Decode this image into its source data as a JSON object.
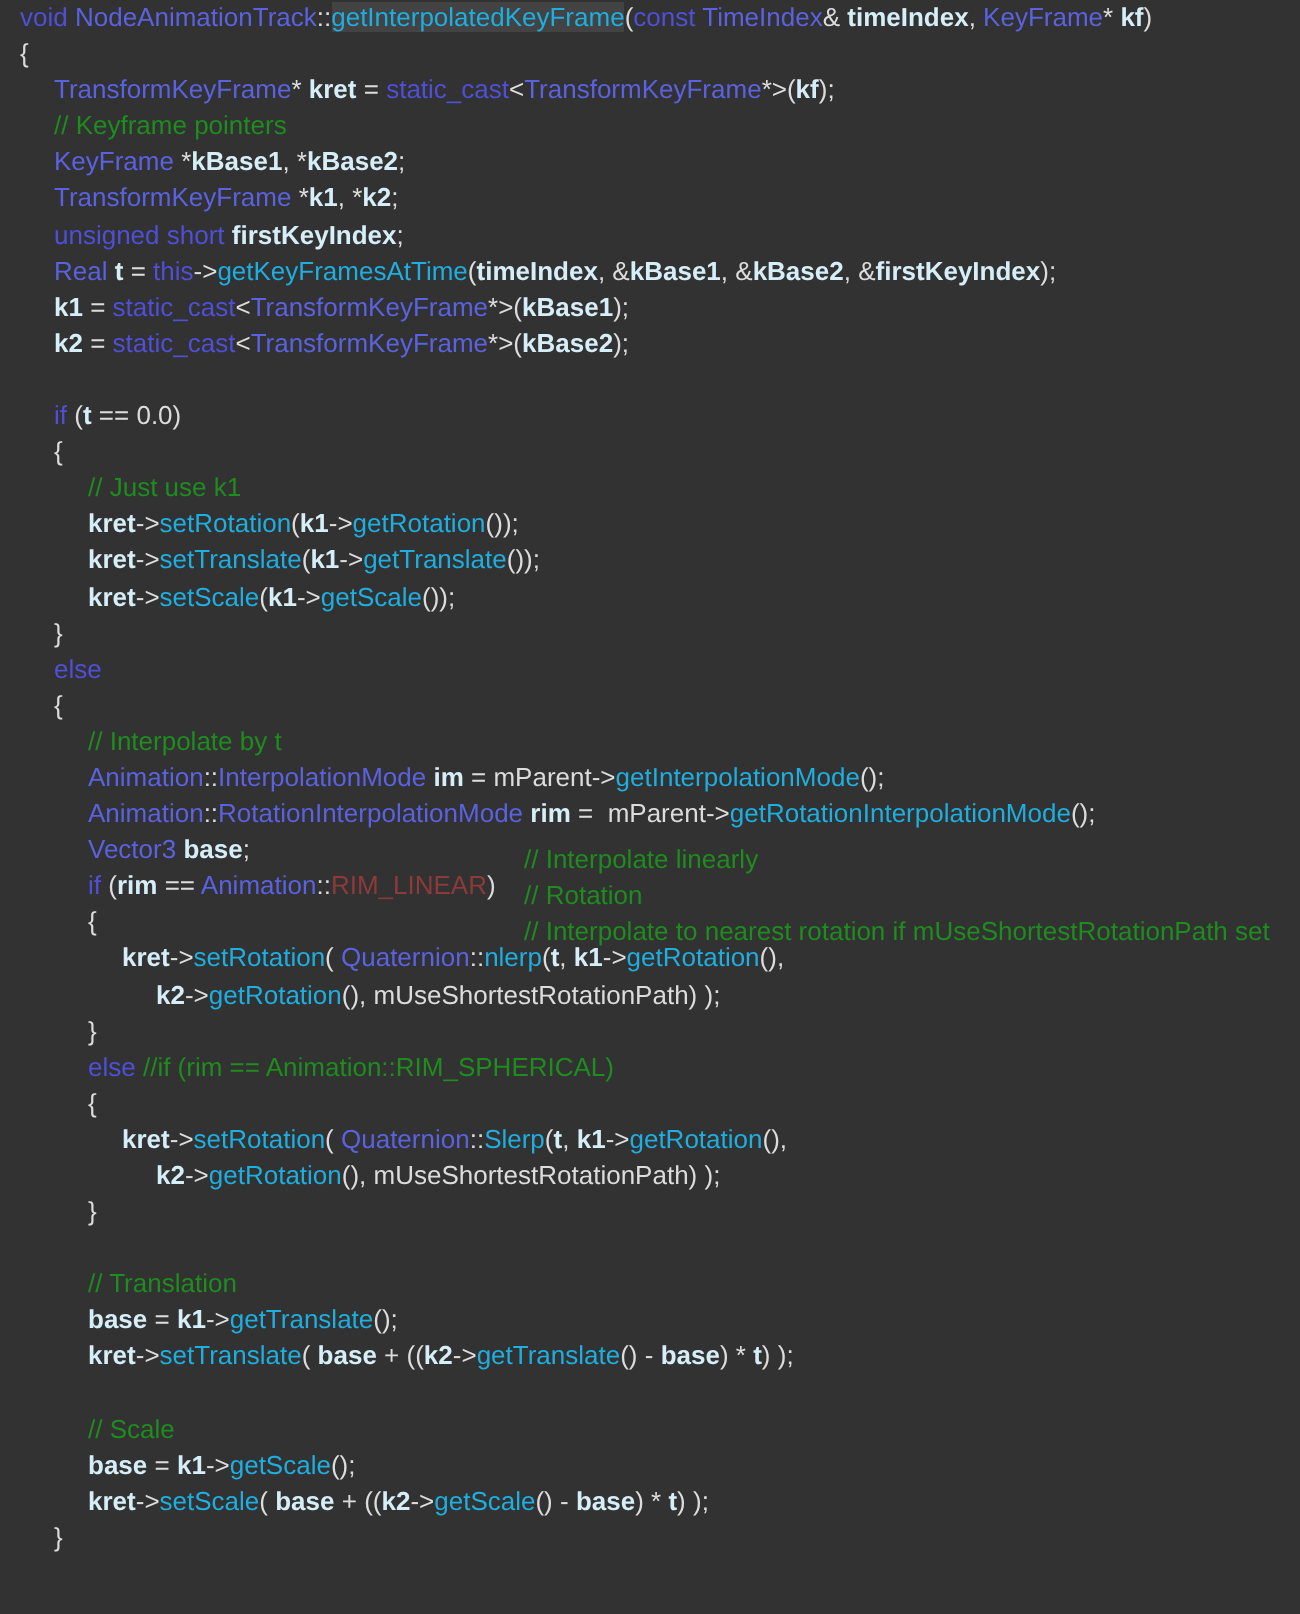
{
  "editor": {
    "lines": [
      {
        "kind": "code",
        "tokens": [
          {
            "kind": "kw",
            "text": "void "
          },
          {
            "kind": "type",
            "text": "NodeAnimationTrack"
          },
          {
            "kind": "op",
            "text": "::"
          },
          {
            "kind": "fnh",
            "text": "getInterpolatedKeyFrame"
          },
          {
            "kind": "op",
            "text": "("
          },
          {
            "kind": "kw",
            "text": "const "
          },
          {
            "kind": "type",
            "text": "TimeIndex"
          },
          {
            "kind": "op",
            "text": "& "
          },
          {
            "kind": "var",
            "text": "timeIndex"
          },
          {
            "kind": "op",
            "text": ", "
          },
          {
            "kind": "type",
            "text": "KeyFrame"
          },
          {
            "kind": "op",
            "text": "* "
          },
          {
            "kind": "var",
            "text": "kf"
          },
          {
            "kind": "op",
            "text": ")"
          }
        ]
      },
      {
        "kind": "code",
        "tokens": [
          {
            "kind": "op",
            "text": "{"
          }
        ]
      },
      {
        "kind": "code",
        "tokens": [
          {
            "kind": "type",
            "text": "\tTransformKeyFrame"
          },
          {
            "kind": "op",
            "text": "* "
          },
          {
            "kind": "var",
            "text": "kret"
          },
          {
            "kind": "op",
            "text": " = "
          },
          {
            "kind": "kw",
            "text": "static_cast"
          },
          {
            "kind": "op",
            "text": "<"
          },
          {
            "kind": "type",
            "text": "TransformKeyFrame"
          },
          {
            "kind": "op",
            "text": "*>("
          },
          {
            "kind": "var",
            "text": "kf"
          },
          {
            "kind": "op",
            "text": ");"
          }
        ]
      },
      {
        "kind": "code",
        "tokens": [
          {
            "kind": "comment",
            "text": "\t// Keyframe pointers"
          }
        ]
      },
      {
        "kind": "code",
        "tokens": [
          {
            "kind": "type",
            "text": "\tKeyFrame "
          },
          {
            "kind": "op",
            "text": "*"
          },
          {
            "kind": "var",
            "text": "kBase1"
          },
          {
            "kind": "op",
            "text": ", *"
          },
          {
            "kind": "var",
            "text": "kBase2"
          },
          {
            "kind": "op",
            "text": ";"
          }
        ]
      },
      {
        "kind": "code",
        "tokens": [
          {
            "kind": "type",
            "text": "\tTransformKeyFrame "
          },
          {
            "kind": "op",
            "text": "*"
          },
          {
            "kind": "var",
            "text": "k1"
          },
          {
            "kind": "op",
            "text": ", *"
          },
          {
            "kind": "var",
            "text": "k2"
          },
          {
            "kind": "op",
            "text": ";"
          }
        ]
      },
      {
        "kind": "code",
        "tokens": [
          {
            "kind": "kw",
            "text": "\tunsigned short "
          },
          {
            "kind": "var",
            "text": "firstKeyIndex"
          },
          {
            "kind": "op",
            "text": ";"
          }
        ]
      },
      {
        "kind": "code",
        "tokens": [
          {
            "kind": "type",
            "text": "\tReal "
          },
          {
            "kind": "var",
            "text": "t"
          },
          {
            "kind": "op",
            "text": " = "
          },
          {
            "kind": "kw",
            "text": "this"
          },
          {
            "kind": "op",
            "text": "->"
          },
          {
            "kind": "fn",
            "text": "getKeyFramesAtTime"
          },
          {
            "kind": "op",
            "text": "("
          },
          {
            "kind": "var",
            "text": "timeIndex"
          },
          {
            "kind": "op",
            "text": ", &"
          },
          {
            "kind": "var",
            "text": "kBase1"
          },
          {
            "kind": "op",
            "text": ", &"
          },
          {
            "kind": "var",
            "text": "kBase2"
          },
          {
            "kind": "op",
            "text": ", &"
          },
          {
            "kind": "var",
            "text": "firstKeyIndex"
          },
          {
            "kind": "op",
            "text": ");"
          }
        ]
      },
      {
        "kind": "code",
        "tokens": [
          {
            "kind": "var",
            "text": "\tk1"
          },
          {
            "kind": "op",
            "text": " = "
          },
          {
            "kind": "kw",
            "text": "static_cast"
          },
          {
            "kind": "op",
            "text": "<"
          },
          {
            "kind": "type",
            "text": "TransformKeyFrame"
          },
          {
            "kind": "op",
            "text": "*>("
          },
          {
            "kind": "var",
            "text": "kBase1"
          },
          {
            "kind": "op",
            "text": ");"
          }
        ]
      },
      {
        "kind": "code",
        "tokens": [
          {
            "kind": "var",
            "text": "\tk2"
          },
          {
            "kind": "op",
            "text": " = "
          },
          {
            "kind": "kw",
            "text": "static_cast"
          },
          {
            "kind": "op",
            "text": "<"
          },
          {
            "kind": "type",
            "text": "TransformKeyFrame"
          },
          {
            "kind": "op",
            "text": "*>("
          },
          {
            "kind": "var",
            "text": "kBase2"
          },
          {
            "kind": "op",
            "text": ");"
          }
        ]
      },
      {
        "kind": "blank"
      },
      {
        "kind": "code",
        "tokens": [
          {
            "kind": "kw",
            "text": "\tif "
          },
          {
            "kind": "op",
            "text": "("
          },
          {
            "kind": "var",
            "text": "t"
          },
          {
            "kind": "op",
            "text": " == 0.0)"
          }
        ]
      },
      {
        "kind": "code",
        "tokens": [
          {
            "kind": "op",
            "text": "\t{"
          }
        ]
      },
      {
        "kind": "code",
        "tokens": [
          {
            "kind": "comment",
            "text": "\t\t// Just use k1"
          }
        ]
      },
      {
        "kind": "code",
        "tokens": [
          {
            "kind": "var",
            "text": "\t\tkret"
          },
          {
            "kind": "op",
            "text": "->"
          },
          {
            "kind": "fn",
            "text": "setRotation"
          },
          {
            "kind": "op",
            "text": "("
          },
          {
            "kind": "var",
            "text": "k1"
          },
          {
            "kind": "op",
            "text": "->"
          },
          {
            "kind": "fn",
            "text": "getRotation"
          },
          {
            "kind": "op",
            "text": "());"
          }
        ]
      },
      {
        "kind": "code",
        "tokens": [
          {
            "kind": "var",
            "text": "\t\tkret"
          },
          {
            "kind": "op",
            "text": "->"
          },
          {
            "kind": "fn",
            "text": "setTranslate"
          },
          {
            "kind": "op",
            "text": "("
          },
          {
            "kind": "var",
            "text": "k1"
          },
          {
            "kind": "op",
            "text": "->"
          },
          {
            "kind": "fn",
            "text": "getTranslate"
          },
          {
            "kind": "op",
            "text": "());"
          }
        ]
      },
      {
        "kind": "code",
        "tokens": [
          {
            "kind": "var",
            "text": "\t\tkret"
          },
          {
            "kind": "op",
            "text": "->"
          },
          {
            "kind": "fn",
            "text": "setScale"
          },
          {
            "kind": "op",
            "text": "("
          },
          {
            "kind": "var",
            "text": "k1"
          },
          {
            "kind": "op",
            "text": "->"
          },
          {
            "kind": "fn",
            "text": "getScale"
          },
          {
            "kind": "op",
            "text": "());"
          }
        ]
      },
      {
        "kind": "code",
        "tokens": [
          {
            "kind": "op",
            "text": "\t}"
          }
        ]
      },
      {
        "kind": "code",
        "tokens": [
          {
            "kind": "kw",
            "text": "\telse"
          }
        ]
      },
      {
        "kind": "code",
        "tokens": [
          {
            "kind": "op",
            "text": "\t{"
          }
        ]
      },
      {
        "kind": "code",
        "tokens": [
          {
            "kind": "comment",
            "text": "\t\t// Interpolate by t"
          }
        ]
      },
      {
        "kind": "code",
        "tokens": [
          {
            "kind": "type",
            "text": "\t\tAnimation"
          },
          {
            "kind": "op",
            "text": "::"
          },
          {
            "kind": "type",
            "text": "InterpolationMode "
          },
          {
            "kind": "var",
            "text": "im"
          },
          {
            "kind": "op",
            "text": " = mParent->"
          },
          {
            "kind": "fn",
            "text": "getInterpolationMode"
          },
          {
            "kind": "op",
            "text": "();"
          }
        ]
      },
      {
        "kind": "code",
        "tokens": [
          {
            "kind": "type",
            "text": "\t\tAnimation"
          },
          {
            "kind": "op",
            "text": "::"
          },
          {
            "kind": "type",
            "text": "RotationInterpolationMode "
          },
          {
            "kind": "var",
            "text": "rim"
          },
          {
            "kind": "op",
            "text": " =  mParent->"
          },
          {
            "kind": "fn",
            "text": "getRotationInterpolationMode"
          },
          {
            "kind": "op",
            "text": "();"
          }
        ]
      },
      {
        "kind": "code",
        "tokens": [
          {
            "kind": "type",
            "text": "\t\tVector3 "
          },
          {
            "kind": "var",
            "text": "base"
          },
          {
            "kind": "op",
            "text": ";"
          }
        ],
        "side_comment": "// Interpolate linearly"
      },
      {
        "kind": "code",
        "tokens": [
          {
            "kind": "kw",
            "text": "\t\tif "
          },
          {
            "kind": "op",
            "text": "("
          },
          {
            "kind": "var",
            "text": "rim"
          },
          {
            "kind": "op",
            "text": " == "
          },
          {
            "kind": "type",
            "text": "Animation"
          },
          {
            "kind": "op",
            "text": "::"
          },
          {
            "kind": "enum",
            "text": "RIM_LINEAR"
          },
          {
            "kind": "op",
            "text": ")"
          }
        ],
        "side_comment": "// Rotation"
      },
      {
        "kind": "code",
        "tokens": [
          {
            "kind": "op",
            "text": "\t\t{"
          }
        ],
        "side_comment": "// Interpolate to nearest rotation if mUseShortestRotationPath set"
      },
      {
        "kind": "code",
        "tokens": [
          {
            "kind": "var",
            "text": "\t\t\tkret"
          },
          {
            "kind": "op",
            "text": "->"
          },
          {
            "kind": "fn",
            "text": "setRotation"
          },
          {
            "kind": "op",
            "text": "( "
          },
          {
            "kind": "type",
            "text": "Quaternion"
          },
          {
            "kind": "op",
            "text": "::"
          },
          {
            "kind": "fn",
            "text": "nlerp"
          },
          {
            "kind": "op",
            "text": "("
          },
          {
            "kind": "var",
            "text": "t"
          },
          {
            "kind": "op",
            "text": ", "
          },
          {
            "kind": "var",
            "text": "k1"
          },
          {
            "kind": "op",
            "text": "->"
          },
          {
            "kind": "fn",
            "text": "getRotation"
          },
          {
            "kind": "op",
            "text": "(),"
          }
        ]
      },
      {
        "kind": "code",
        "tokens": [
          {
            "kind": "var",
            "text": "\t\t\t\tk2"
          },
          {
            "kind": "op",
            "text": "->"
          },
          {
            "kind": "fn",
            "text": "getRotation"
          },
          {
            "kind": "op",
            "text": "(), mUseShortestRotationPath) );"
          }
        ]
      },
      {
        "kind": "code",
        "tokens": [
          {
            "kind": "op",
            "text": "\t\t}"
          }
        ]
      },
      {
        "kind": "code",
        "tokens": [
          {
            "kind": "kw",
            "text": "\t\telse "
          },
          {
            "kind": "comment",
            "text": "//if (rim == Animation::RIM_SPHERICAL)"
          }
        ]
      },
      {
        "kind": "code",
        "tokens": [
          {
            "kind": "op",
            "text": "\t\t{"
          }
        ]
      },
      {
        "kind": "code",
        "tokens": [
          {
            "kind": "var",
            "text": "\t\t\tkret"
          },
          {
            "kind": "op",
            "text": "->"
          },
          {
            "kind": "fn",
            "text": "setRotation"
          },
          {
            "kind": "op",
            "text": "( "
          },
          {
            "kind": "type",
            "text": "Quaternion"
          },
          {
            "kind": "op",
            "text": "::"
          },
          {
            "kind": "fn",
            "text": "Slerp"
          },
          {
            "kind": "op",
            "text": "("
          },
          {
            "kind": "var",
            "text": "t"
          },
          {
            "kind": "op",
            "text": ", "
          },
          {
            "kind": "var",
            "text": "k1"
          },
          {
            "kind": "op",
            "text": "->"
          },
          {
            "kind": "fn",
            "text": "getRotation"
          },
          {
            "kind": "op",
            "text": "(),"
          }
        ]
      },
      {
        "kind": "code",
        "tokens": [
          {
            "kind": "var",
            "text": "\t\t\t\tk2"
          },
          {
            "kind": "op",
            "text": "->"
          },
          {
            "kind": "fn",
            "text": "getRotation"
          },
          {
            "kind": "op",
            "text": "(), mUseShortestRotationPath) );"
          }
        ]
      },
      {
        "kind": "code",
        "tokens": [
          {
            "kind": "op",
            "text": "\t\t}"
          }
        ]
      },
      {
        "kind": "blank"
      },
      {
        "kind": "code",
        "tokens": [
          {
            "kind": "comment",
            "text": "\t\t// Translation"
          }
        ]
      },
      {
        "kind": "code",
        "tokens": [
          {
            "kind": "var",
            "text": "\t\tbase"
          },
          {
            "kind": "op",
            "text": " = "
          },
          {
            "kind": "var",
            "text": "k1"
          },
          {
            "kind": "op",
            "text": "->"
          },
          {
            "kind": "fn",
            "text": "getTranslate"
          },
          {
            "kind": "op",
            "text": "();"
          }
        ]
      },
      {
        "kind": "code",
        "tokens": [
          {
            "kind": "var",
            "text": "\t\tkret"
          },
          {
            "kind": "op",
            "text": "->"
          },
          {
            "kind": "fn",
            "text": "setTranslate"
          },
          {
            "kind": "op",
            "text": "( "
          },
          {
            "kind": "var",
            "text": "base"
          },
          {
            "kind": "op",
            "text": " + (("
          },
          {
            "kind": "var",
            "text": "k2"
          },
          {
            "kind": "op",
            "text": "->"
          },
          {
            "kind": "fn",
            "text": "getTranslate"
          },
          {
            "kind": "op",
            "text": "() - "
          },
          {
            "kind": "var",
            "text": "base"
          },
          {
            "kind": "op",
            "text": ") * "
          },
          {
            "kind": "var",
            "text": "t"
          },
          {
            "kind": "op",
            "text": ") );"
          }
        ]
      },
      {
        "kind": "blank"
      },
      {
        "kind": "code",
        "tokens": [
          {
            "kind": "comment",
            "text": "\t\t// Scale"
          }
        ]
      },
      {
        "kind": "code",
        "tokens": [
          {
            "kind": "var",
            "text": "\t\tbase"
          },
          {
            "kind": "op",
            "text": " = "
          },
          {
            "kind": "var",
            "text": "k1"
          },
          {
            "kind": "op",
            "text": "->"
          },
          {
            "kind": "fn",
            "text": "getScale"
          },
          {
            "kind": "op",
            "text": "();"
          }
        ]
      },
      {
        "kind": "code",
        "tokens": [
          {
            "kind": "var",
            "text": "\t\tkret"
          },
          {
            "kind": "op",
            "text": "->"
          },
          {
            "kind": "fn",
            "text": "setScale"
          },
          {
            "kind": "op",
            "text": "( "
          },
          {
            "kind": "var",
            "text": "base"
          },
          {
            "kind": "op",
            "text": " + (("
          },
          {
            "kind": "var",
            "text": "k2"
          },
          {
            "kind": "op",
            "text": "->"
          },
          {
            "kind": "fn",
            "text": "getScale"
          },
          {
            "kind": "op",
            "text": "() - "
          },
          {
            "kind": "var",
            "text": "base"
          },
          {
            "kind": "op",
            "text": ") * "
          },
          {
            "kind": "var",
            "text": "t"
          },
          {
            "kind": "op",
            "text": ") );"
          }
        ]
      },
      {
        "kind": "code",
        "tokens": [
          {
            "kind": "op",
            "text": "\t}"
          }
        ]
      }
    ]
  }
}
